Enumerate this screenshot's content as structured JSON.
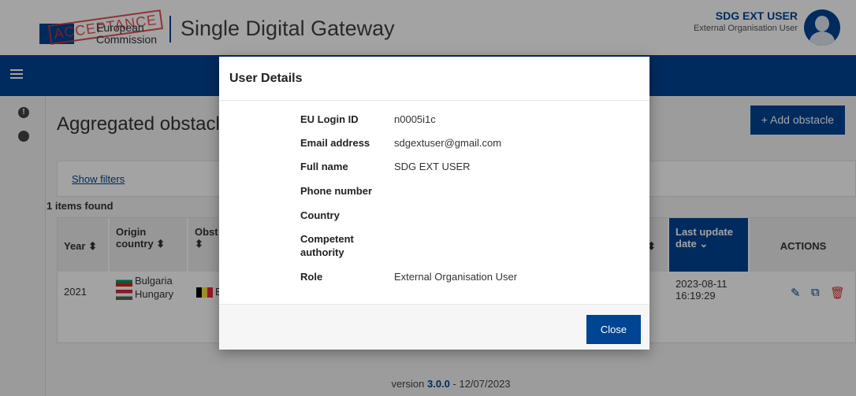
{
  "header": {
    "logo_stamp": "ACCEPTANCE",
    "logo_line1": "European",
    "logo_line2": "Commission",
    "app_title": "Single Digital Gateway",
    "user_name": "SDG EXT USER",
    "user_role": "External Organisation User"
  },
  "main": {
    "page_title": "Aggregated obstacl",
    "add_button": "+ Add obstacle",
    "show_filters": "Show filters",
    "items_found": "1 items found",
    "columns": {
      "year": "Year ⬍",
      "origin_line1": "Origin",
      "origin_line2": "country ⬍",
      "obst_line1": "Obst",
      "obst_line2": "⬍",
      "hidden_sort": "⬍",
      "last_update_line1": "Last update",
      "last_update_line2": "date ⌄",
      "actions": "ACTIONS"
    },
    "row": {
      "year": "2021",
      "country1": "Bulgaria",
      "country2": "Hungary",
      "obst_fragment": "B",
      "date_line1": "2023-08-11",
      "date_line2": "16:19:29"
    },
    "version_prefix": "version ",
    "version_number": "3.0.0",
    "version_suffix": " - 12/07/2023"
  },
  "modal": {
    "title": "User Details",
    "fields": [
      {
        "label": "EU Login ID",
        "value": "n0005i1c"
      },
      {
        "label": "Email address",
        "value": "sdgextuser@gmail.com"
      },
      {
        "label": "Full name",
        "value": "SDG EXT USER"
      },
      {
        "label": "Phone number",
        "value": ""
      },
      {
        "label": "Country",
        "value": ""
      },
      {
        "label": "Competent authority",
        "value": ""
      },
      {
        "label": "Role",
        "value": "External Organisation User"
      }
    ],
    "close_button": "Close"
  },
  "colors": {
    "primary": "#004494",
    "delete": "#d32f2f"
  }
}
